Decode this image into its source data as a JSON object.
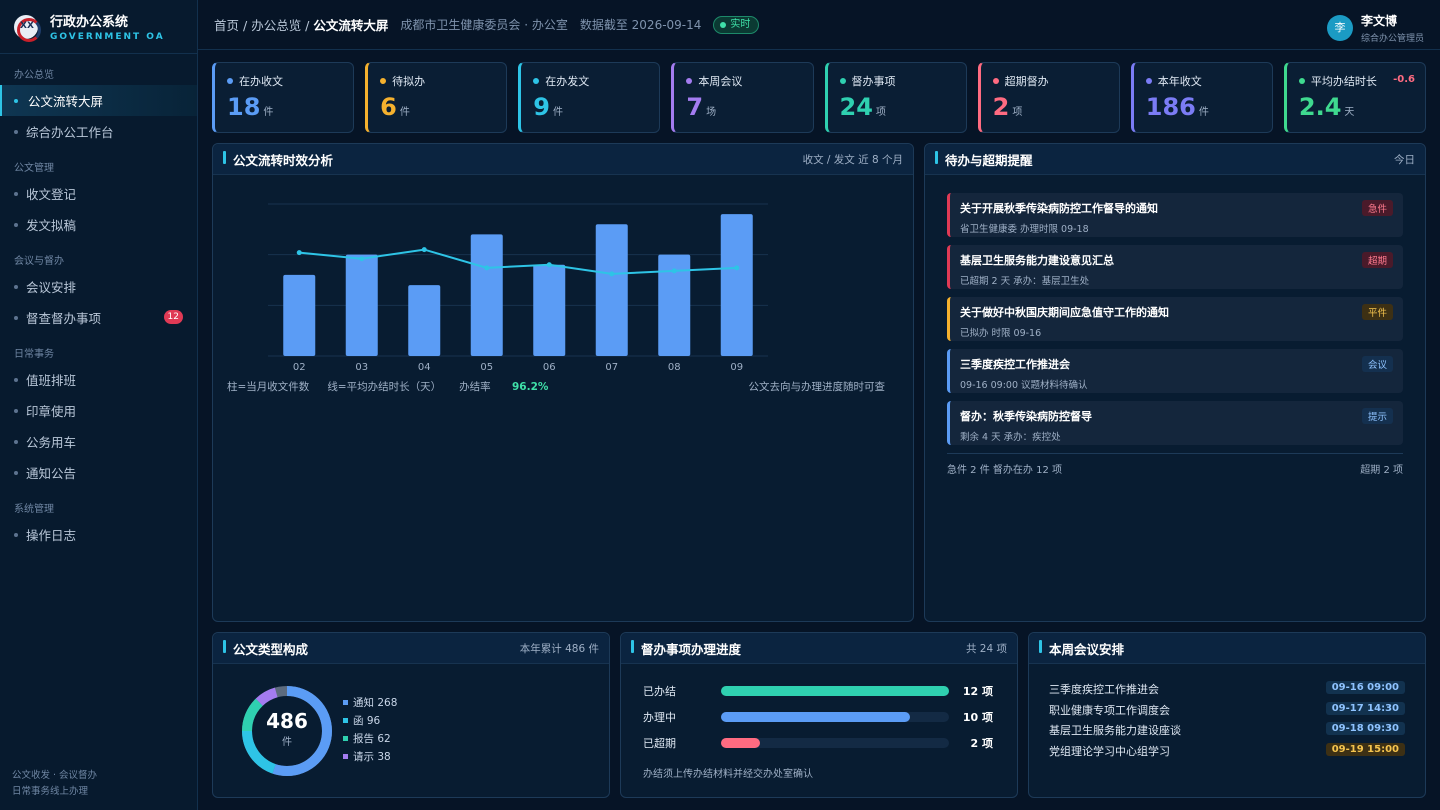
{
  "app": {
    "title": "行政办公系统",
    "subtitle": "GOVERNMENT OA",
    "logo_mark": "XX"
  },
  "sidebar": {
    "groups": [
      {
        "label": "办公总览",
        "items": [
          {
            "label": "公文流转大屏",
            "active": true
          },
          {
            "label": "综合办公工作台"
          }
        ]
      },
      {
        "label": "公文管理",
        "items": [
          {
            "label": "收文登记"
          },
          {
            "label": "发文拟稿"
          }
        ]
      },
      {
        "label": "会议与督办",
        "items": [
          {
            "label": "会议安排"
          },
          {
            "label": "督查督办事项",
            "badge": "12"
          }
        ]
      },
      {
        "label": "日常事务",
        "items": [
          {
            "label": "值班排班"
          },
          {
            "label": "印章使用"
          },
          {
            "label": "公务用车"
          },
          {
            "label": "通知公告"
          }
        ]
      },
      {
        "label": "系统管理",
        "items": [
          {
            "label": "操作日志"
          }
        ]
      }
    ],
    "footer_line1": "公文收发 · 会议督办",
    "footer_line2": "日常事务线上办理"
  },
  "topbar": {
    "crumb_home": "首页",
    "crumb_section": "办公总览",
    "crumb_current": "公文流转大屏",
    "org": "成都市卫生健康委员会 · 办公室",
    "data_as_of": "数据截至 2026-09-14",
    "live_label": "实时",
    "user_initial": "李",
    "user_name": "李文博",
    "user_role": "综合办公管理员"
  },
  "kpis": [
    {
      "label": "在办收文",
      "value": "18",
      "unit": "件",
      "color": "#5b9cf5"
    },
    {
      "label": "待拟办",
      "value": "6",
      "unit": "件",
      "color": "#f5b12e"
    },
    {
      "label": "在办发文",
      "value": "9",
      "unit": "件",
      "color": "#2ec4e6"
    },
    {
      "label": "本周会议",
      "value": "7",
      "unit": "场",
      "color": "#a47cf0"
    },
    {
      "label": "督办事项",
      "value": "24",
      "unit": "项",
      "color": "#2fd0b0"
    },
    {
      "label": "超期督办",
      "value": "2",
      "unit": "项",
      "color": "#ff6b81"
    },
    {
      "label": "本年收文",
      "value": "186",
      "unit": "件",
      "color": "#7b7cf5"
    },
    {
      "label": "平均办结时长",
      "value": "2.4",
      "unit": "天",
      "color": "#3fd98f",
      "delta": "-0.6"
    }
  ],
  "flow_panel": {
    "title": "公文流转时效分析",
    "aux": "收文 / 发文   近 8 个月",
    "legend_bar": "柱=当月收文件数",
    "legend_line": "线=平均办结时长（天）",
    "rate_label": "办结率",
    "rate_value": "96.2%",
    "note": "公文去向与办理进度随时可查"
  },
  "chart_data": {
    "type": "bar",
    "categories": [
      "02",
      "03",
      "04",
      "05",
      "06",
      "07",
      "08",
      "09"
    ],
    "series": [
      {
        "name": "当月收文件数",
        "type": "bar",
        "values": [
          16,
          20,
          14,
          24,
          18,
          26,
          20,
          28
        ]
      },
      {
        "name": "平均办结时长（天）",
        "type": "line",
        "values": [
          3.4,
          3.2,
          3.5,
          2.9,
          3.0,
          2.7,
          2.8,
          2.9
        ]
      }
    ],
    "ylim_bar": [
      0,
      30
    ],
    "ylim_line": [
      0,
      5
    ],
    "grid": true,
    "line_color": "#2ec4e6",
    "bar_color": "#5b9cf5"
  },
  "alerts_panel": {
    "title": "待办与超期提醒",
    "aux": "今日",
    "items": [
      {
        "title": "关于开展秋季传染病防控工作督导的通知",
        "sub": "省卫生健康委   办理时限 09-18",
        "tag": "急件",
        "color": "#e03a55",
        "tag_bg": "#4a1a2a",
        "tag_fg": "#ff7b8f"
      },
      {
        "title": "基层卫生服务能力建设意见汇总",
        "sub": "已超期 2 天   承办：基层卫生处",
        "tag": "超期",
        "color": "#e03a55",
        "tag_bg": "#4a1a2a",
        "tag_fg": "#ff7b8f"
      },
      {
        "title": "关于做好中秋国庆期间应急值守工作的通知",
        "sub": "已拟办   时限 09-16",
        "tag": "平件",
        "color": "#f5b12e",
        "tag_bg": "#3d3014",
        "tag_fg": "#f5c44e"
      },
      {
        "title": "三季度疾控工作推进会",
        "sub": "09-16 09:00   议题材料待确认",
        "tag": "会议",
        "color": "#5b9cf5",
        "tag_bg": "#14304f",
        "tag_fg": "#8fc3ff"
      },
      {
        "title": "督办：秋季传染病防控督导",
        "sub": "剩余 4 天   承办：疾控处",
        "tag": "提示",
        "color": "#5b9cf5",
        "tag_bg": "#14304f",
        "tag_fg": "#8fc3ff"
      }
    ],
    "footer_left": "急件 2 件   督办在办 12 项",
    "footer_right": "超期 2 项"
  },
  "doc_types": {
    "title": "公文类型构成",
    "aux": "本年累计 486 件",
    "total": "486",
    "total_unit": "件",
    "items": [
      {
        "name": "通知",
        "value": 268,
        "label": "通知 268",
        "color": "#5b9cf5"
      },
      {
        "name": "函",
        "value": 96,
        "label": "函 96",
        "color": "#2ec4e6"
      },
      {
        "name": "报告",
        "value": 62,
        "label": "报告 62",
        "color": "#2fd0b0"
      },
      {
        "name": "请示",
        "value": 38,
        "label": "请示 38",
        "color": "#a47cf0"
      }
    ],
    "remainder_color": "#5d6b7e"
  },
  "supervision": {
    "title": "督办事项办理进度",
    "aux": "共 24 项",
    "rows": [
      {
        "label": "已办结",
        "value": "12 项",
        "fraction": 1.0,
        "color": "#2fd0b0"
      },
      {
        "label": "办理中",
        "value": "10 项",
        "fraction": 0.83,
        "color": "#5b9cf5"
      },
      {
        "label": "已超期",
        "value": "2 项",
        "fraction": 0.17,
        "color": "#ff6b81"
      }
    ],
    "note": "办结须上传办结材料并经交办处室确认"
  },
  "meetings": {
    "title": "本周会议安排",
    "items": [
      {
        "name": "三季度疾控工作推进会",
        "time": "09-16 09:00"
      },
      {
        "name": "职业健康专项工作调度会",
        "time": "09-17 14:30"
      },
      {
        "name": "基层卫生服务能力建设座谈",
        "time": "09-18 09:30"
      },
      {
        "name": "党组理论学习中心组学习",
        "time": "09-19 15:00",
        "highlight": true
      }
    ]
  }
}
